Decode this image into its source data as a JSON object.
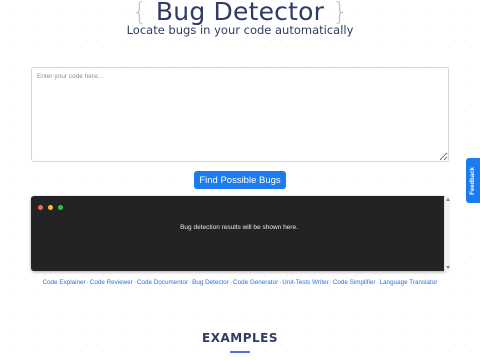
{
  "header": {
    "brace_open": "{",
    "title": "Bug Detector",
    "brace_close": "}",
    "subtitle": "Locate bugs in your code automatically"
  },
  "input": {
    "placeholder": "Enter your code here..."
  },
  "actions": {
    "find_label": "Find Possible Bugs"
  },
  "results": {
    "placeholder_text": "Bug detection results will be shown here."
  },
  "tools": [
    {
      "label": "Code Explainer"
    },
    {
      "label": "Code Reviewer"
    },
    {
      "label": "Code Documentor"
    },
    {
      "label": "Bug Detector"
    },
    {
      "label": "Code Generator"
    },
    {
      "label": "Unit-Tests Writer"
    },
    {
      "label": "Code Simplifier"
    },
    {
      "label": "Language Translator"
    }
  ],
  "tools_separator": "·",
  "examples": {
    "heading": "EXAMPLES"
  },
  "feedback": {
    "label": "Feedback"
  },
  "colors": {
    "accent": "#1a7cf0",
    "title": "#2f3b66",
    "terminal_bg": "#232326",
    "link": "#2f6fd6"
  }
}
